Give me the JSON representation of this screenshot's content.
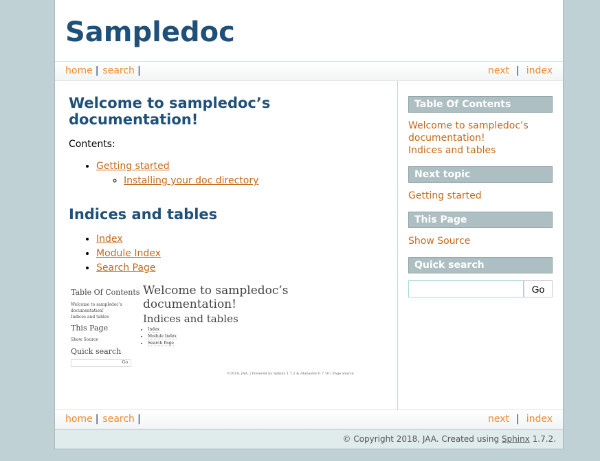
{
  "header": {
    "title": "Sampledoc"
  },
  "nav": {
    "home": "home",
    "search": "search",
    "next": "next",
    "index": "index",
    "sep": "|"
  },
  "main": {
    "title": "Welcome to sampledoc’s documentation!",
    "contents_label": "Contents:",
    "toc": [
      {
        "label": "Getting started",
        "children": [
          "Installing your doc directory"
        ]
      }
    ],
    "indices_title": "Indices and tables",
    "indices": [
      "Index",
      "Module Index",
      "Search Page"
    ]
  },
  "sidebar": {
    "toc_title": "Table Of Contents",
    "toc_items": [
      "Welcome to sampledoc’s documentation!",
      "Indices and tables"
    ],
    "next_title": "Next topic",
    "next_link": "Getting started",
    "page_title": "This Page",
    "show_source": "Show Source",
    "search_title": "Quick search",
    "search_value": "",
    "go": "Go"
  },
  "screenshot": {
    "toc_title": "Table Of Contents",
    "toc_1": "Welcome to sampledoc’s documentation!",
    "toc_2": "Indices and tables",
    "this_page": "This Page",
    "show_source": "Show Source",
    "quick_search": "Quick search",
    "go": "Go",
    "title": "Welcome to sampledoc’s documentation!",
    "indices_title": "Indices and tables",
    "indices": [
      "Index",
      "Module Index",
      "Search Page"
    ],
    "footer": "©2018, JAA. | Powered by Sphinx 1.7.2 & Alabaster 0.7.10 | Page source"
  },
  "footer": {
    "copyright": "© Copyright 2018, JAA. Created using ",
    "sphinx": "Sphinx",
    "version": " 1.7.2."
  }
}
